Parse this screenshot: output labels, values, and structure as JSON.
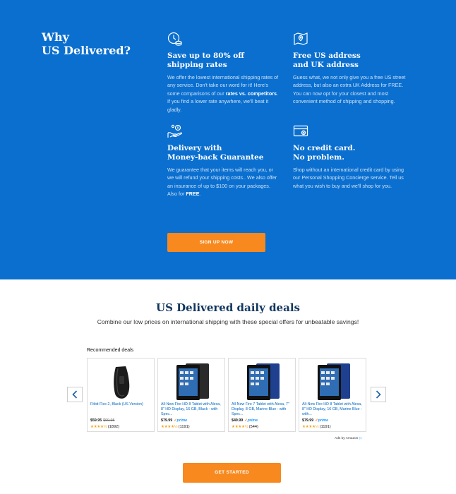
{
  "why": {
    "title_line1": "Why",
    "title_line2": "US Delivered?",
    "features": [
      {
        "icon": "clock-coins-icon",
        "title_line1": "Save up to 80% off",
        "title_line2": "shipping rates",
        "text_before": "We offer the lowest international shipping rates of any service. Don't take our word for it! Here's some comparisons of our ",
        "text_bold": "rates vs. competitors",
        "text_after": ". If you find a lower rate anywhere, we'll beat it gladly."
      },
      {
        "icon": "map-pin-icon",
        "title_line1": "Free US address",
        "title_line2": "and UK address",
        "text": "Guess what, we not only give you a free US street address, but also an extra UK Address for FREE. You can now opt for your closest and most convenient method of shipping and shopping."
      },
      {
        "icon": "hand-money-icon",
        "title_line1": "Delivery with",
        "title_line2": "Money-back Guarantee",
        "text_before": "We guarantee that your items will reach you, or we will refund your shipping costs.. We also offer an insurance of up to $100 on your packages. Also for ",
        "text_bold": "FREE",
        "text_after": "."
      },
      {
        "icon": "credit-card-icon",
        "title_line1": "No credit card.",
        "title_line2": "No problem.",
        "text": "Shop without an international credit card by using our Personal Shopping Concierge service. Tell us what you wish to buy and we'll shop for you."
      }
    ],
    "signup_label": "SIGN UP NOW"
  },
  "deals": {
    "title": "US Delivered daily deals",
    "subtitle": "Combine our low prices on international shipping with these special offers for unbeatable savings!",
    "recommended_label": "Recommended deals",
    "products": [
      {
        "image_icon": "fitness-band-icon",
        "title": "Fitbit Flex 2, Black (US Version)",
        "price": "$59.95",
        "was": "$99.95",
        "prime": false,
        "stars": "★★★★½",
        "reviews": "(1892)"
      },
      {
        "image_icon": "tablet-black-icon",
        "title": "All-New Fire HD 8 Tablet with Alexa, 8\" HD Display, 16 GB, Black - with Spec...",
        "price": "$79.99",
        "was": "",
        "prime": true,
        "stars": "★★★★½",
        "reviews": "(1191)"
      },
      {
        "image_icon": "tablet-blue-icon",
        "title": "All-New Fire 7 Tablet with Alexa, 7\" Display, 8 GB, Marine Blue - with Spec...",
        "price": "$49.99",
        "was": "",
        "prime": true,
        "stars": "★★★★½",
        "reviews": "(544)"
      },
      {
        "image_icon": "tablet-blue-icon",
        "title": "All-New Fire HD 8 Tablet with Alexa, 8\" HD Display, 16 GB, Marine Blue - with...",
        "price": "$79.99",
        "was": "",
        "prime": true,
        "stars": "★★★★½",
        "reviews": "(1191)"
      }
    ],
    "prime_label": "prime",
    "ads_label": "Ads by Amazon",
    "get_started_label": "GET STARTED"
  },
  "colors": {
    "brand_blue": "#0a6fcf",
    "accent_orange": "#f7891f",
    "heading_navy": "#10365f",
    "link_blue": "#0066c0"
  }
}
